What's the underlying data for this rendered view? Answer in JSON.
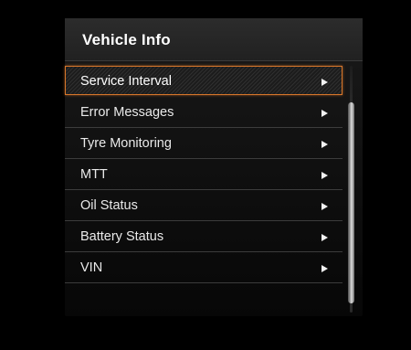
{
  "header": {
    "title": "Vehicle Info"
  },
  "menu": {
    "items": [
      {
        "label": "Service Interval",
        "selected": true
      },
      {
        "label": "Error Messages",
        "selected": false
      },
      {
        "label": "Tyre Monitoring",
        "selected": false
      },
      {
        "label": "MTT",
        "selected": false
      },
      {
        "label": "Oil Status",
        "selected": false
      },
      {
        "label": "Battery Status",
        "selected": false
      },
      {
        "label": "VIN",
        "selected": false
      }
    ],
    "arrow_icon": "right-triangle-icon"
  },
  "colors": {
    "selection_border": "#d8762a",
    "background": "#000000",
    "header_bg": "#262626",
    "text": "#eaeaea"
  }
}
